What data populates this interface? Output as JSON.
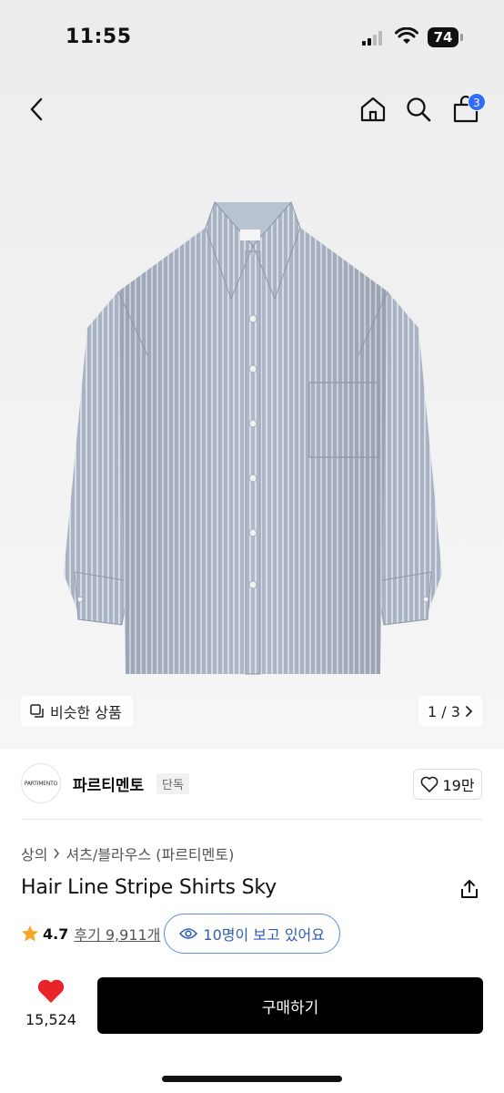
{
  "status": {
    "time": "11:55",
    "battery": "74"
  },
  "nav": {
    "cart_count": "3"
  },
  "image": {
    "similar_label": "비슷한 상품",
    "pager": "1 / 3"
  },
  "brand": {
    "logo_text": "PARTIMENTO",
    "name": "파르티멘토",
    "tag": "단독",
    "likes": "19만"
  },
  "product": {
    "breadcrumb": [
      "상의",
      "셔츠/블라우스 (파르티멘토)"
    ],
    "title": "Hair Line Stripe Shirts Sky",
    "rating": "4.7",
    "reviews": "후기 9,911개",
    "viewers": "10명이 보고 있어요"
  },
  "bottom": {
    "heart_count": "15,524",
    "buy_label": "구매하기"
  },
  "colors": {
    "accent_blue": "#2f6bff",
    "heart_red": "#e8232a",
    "star": "#f5a623",
    "buy_bg": "#000000"
  }
}
